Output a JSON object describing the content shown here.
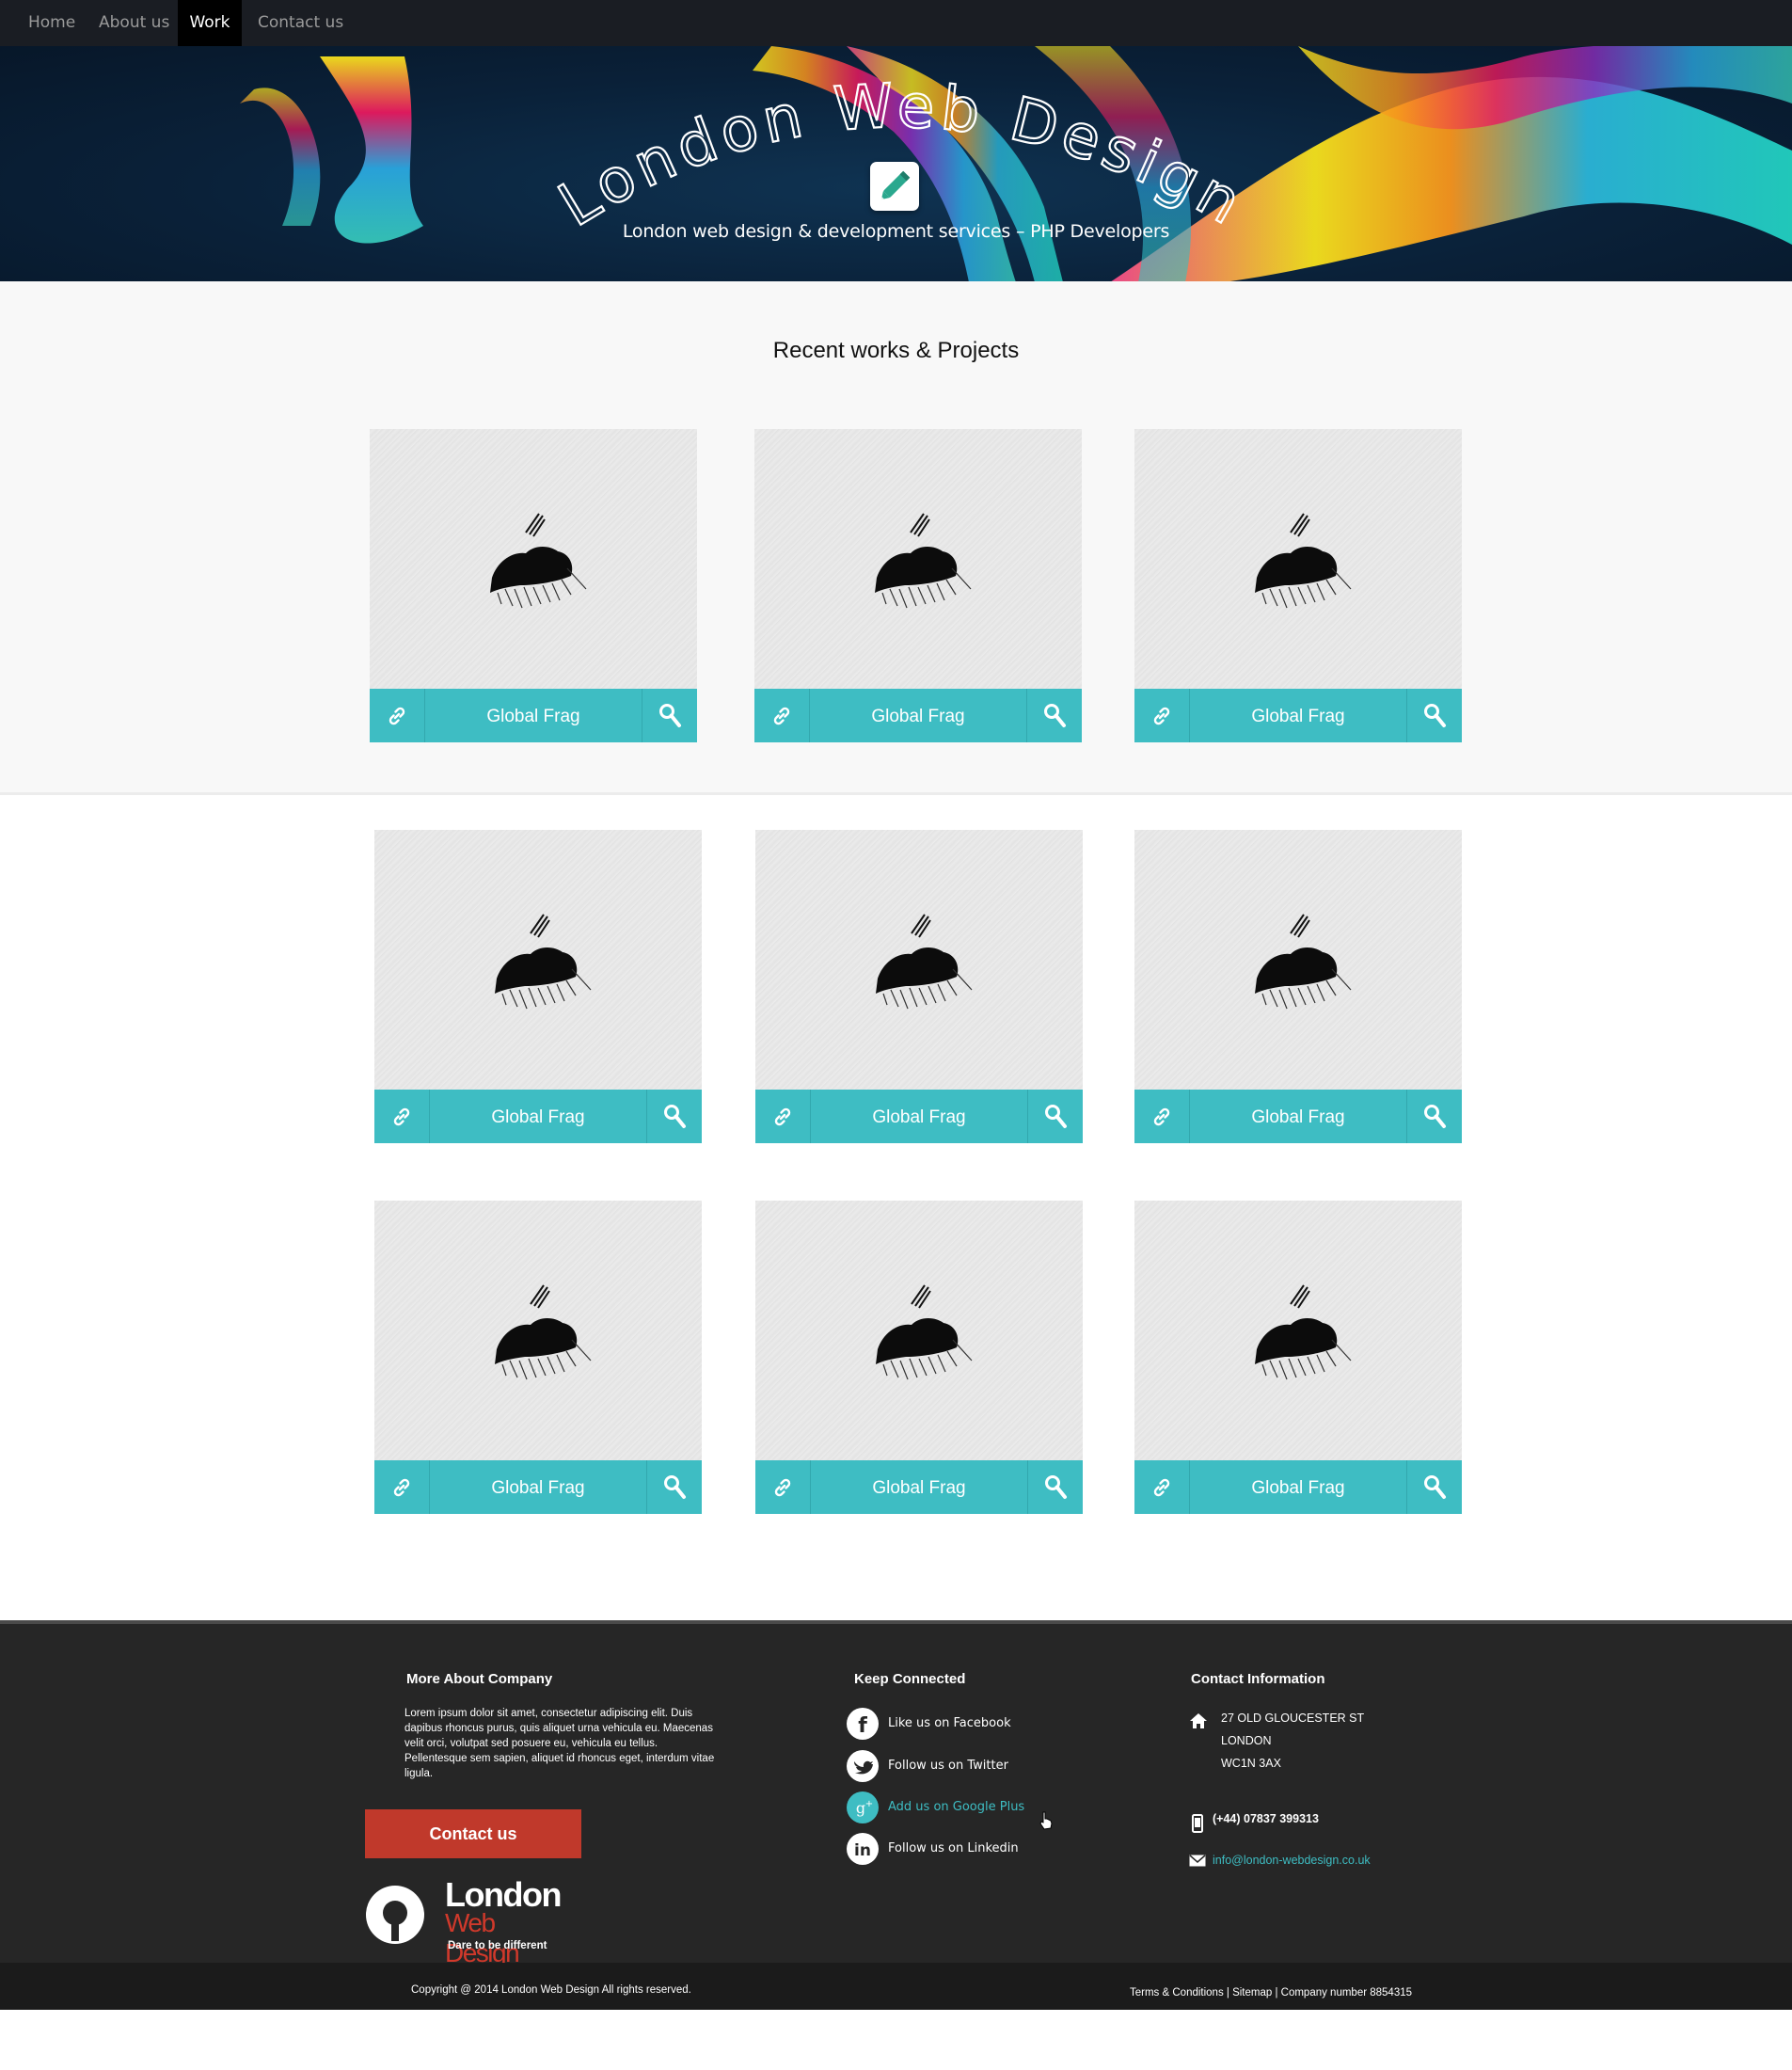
{
  "nav": {
    "items": [
      {
        "label": "Home"
      },
      {
        "label": "About us"
      },
      {
        "label": "Work"
      },
      {
        "label": "Contact us"
      }
    ],
    "active": "Work"
  },
  "hero": {
    "title": "London Web Design",
    "subtitle": "London web design & development services – PHP Developers",
    "badge_icon": "pencil-icon"
  },
  "works": {
    "section_title": "Recent works & Projects",
    "items": [
      {
        "title": "Global Frag"
      },
      {
        "title": "Global Frag"
      },
      {
        "title": "Global Frag"
      },
      {
        "title": "Global Frag"
      },
      {
        "title": "Global Frag"
      },
      {
        "title": "Global Frag"
      },
      {
        "title": "Global Frag"
      },
      {
        "title": "Global Frag"
      },
      {
        "title": "Global Frag"
      }
    ],
    "link_icon": "link-icon",
    "zoom_icon": "magnifier-icon"
  },
  "footer": {
    "about": {
      "heading": "More About Company",
      "text": "Lorem ipsum dolor sit amet, consectetur adipiscing elit. Duis dapibus rhoncus purus, quis aliquet urna vehicula eu. Maecenas velit orci, volutpat sed posuere eu, vehicula eu tellus. Pellentesque sem sapien, aliquet id rhoncus eget, interdum vitae ligula.",
      "button": "Contact us"
    },
    "logo": {
      "line1": "London",
      "line2": "Web Design",
      "tagline": "Dare to be different"
    },
    "social": {
      "heading": "Keep Connected",
      "items": [
        {
          "label": "Like us on Facebook",
          "icon": "facebook-icon"
        },
        {
          "label": "Follow us on Twitter",
          "icon": "twitter-icon"
        },
        {
          "label": "Add us on Google Plus",
          "icon": "google-plus-icon"
        },
        {
          "label": "Follow us on Linkedin",
          "icon": "linkedin-icon"
        }
      ]
    },
    "contact": {
      "heading": "Contact Information",
      "address_line1": "27 OLD GLOUCESTER ST",
      "address_line2": "LONDON",
      "address_line3": "WC1N 3AX",
      "phone": "(+44) 07837 399313",
      "email": "info@london-webdesign.co.uk"
    },
    "copyright": "Copyright @  2014 London Web Design All rights reserved.",
    "legal_links": "Terms & Conditions | Sitemap | Company number 8854315"
  },
  "colors": {
    "accent_teal": "#3ebdc3",
    "button_red": "#c0392b",
    "footer_bg": "#262626",
    "nav_bg": "#1a1d23"
  }
}
